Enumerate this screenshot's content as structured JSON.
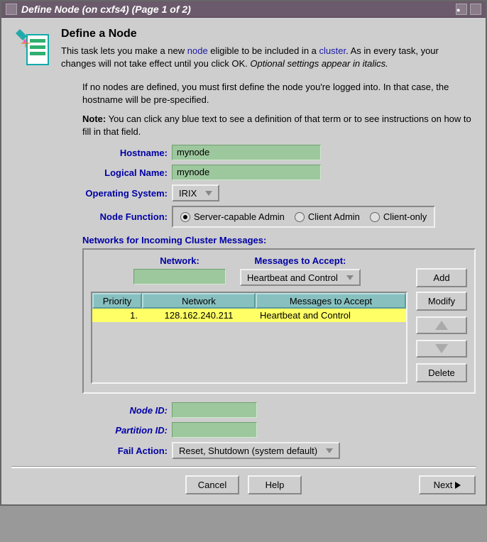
{
  "window": {
    "title": "Define Node (on cxfs4) (Page 1 of 2)"
  },
  "header": {
    "heading": "Define a Node",
    "intro_prefix": "This task lets you make a new ",
    "link_node": "node",
    "intro_mid": " eligible to be included in a ",
    "link_cluster": "cluster",
    "intro_suffix": ".  As in every task, your changes will not take effect until you click OK.  ",
    "intro_italic": "Optional settings appear in italics.",
    "para2": "If no nodes are defined, you must first define the node you're logged into.  In that case, the hostname will be pre-specified.",
    "note_bold": "Note:",
    "note_rest": " You can click any blue text to see a definition of that term or to see instructions on how to fill in that field."
  },
  "form": {
    "hostname_label": "Hostname:",
    "hostname_value": "mynode",
    "logicalname_label": "Logical Name:",
    "logicalname_value": "mynode",
    "os_label": "Operating System:",
    "os_value": "IRIX",
    "nodefn_label": "Node Function:",
    "nodefn_options": {
      "opt1": "Server-capable Admin",
      "opt2": "Client Admin",
      "opt3": "Client-only"
    },
    "nodeid_label": "Node ID:",
    "nodeid_value": "",
    "partitionid_label": "Partition ID:",
    "partitionid_value": "",
    "failaction_label": "Fail Action:",
    "failaction_value": "Reset, Shutdown (system default)"
  },
  "networks": {
    "section_title": "Networks for Incoming Cluster Messages:",
    "network_label": "Network:",
    "network_value": "",
    "messages_label": "Messages to Accept:",
    "messages_value": "Heartbeat and Control",
    "buttons": {
      "add": "Add",
      "modify": "Modify",
      "delete": "Delete"
    },
    "columns": {
      "priority": "Priority",
      "network": "Network",
      "messages": "Messages to Accept"
    },
    "rows": [
      {
        "priority": "1.",
        "network": "128.162.240.211",
        "messages": "Heartbeat and Control"
      }
    ]
  },
  "footer": {
    "cancel": "Cancel",
    "help": "Help",
    "next": "Next"
  }
}
